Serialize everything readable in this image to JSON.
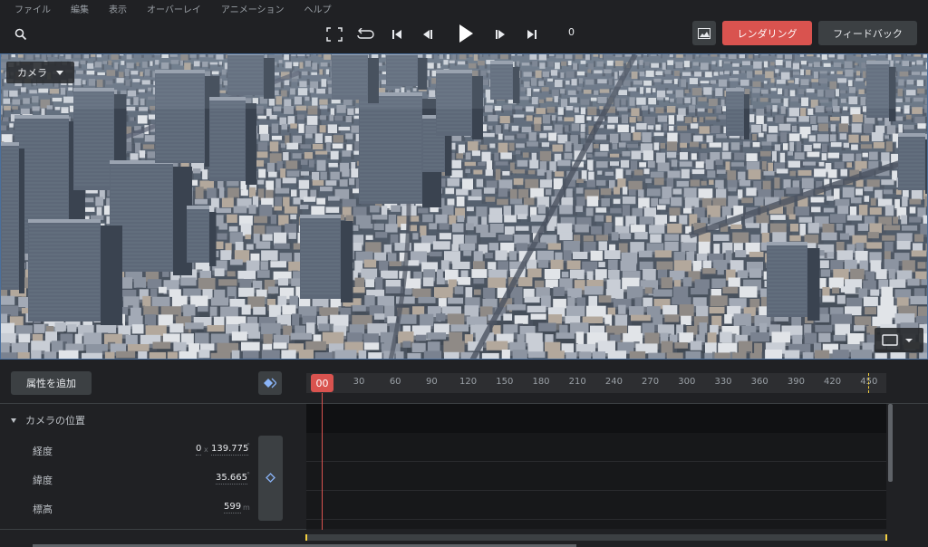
{
  "menu": [
    "ファイル",
    "編集",
    "表示",
    "オーバーレイ",
    "アニメーション",
    "ヘルプ"
  ],
  "toolbar": {
    "frame": "0",
    "render_label": "レンダリング",
    "feedback_label": "フィードバック"
  },
  "viewport": {
    "camera_label": "カメラ"
  },
  "timeline": {
    "add_property_label": "属性を追加",
    "playhead_label": "00",
    "ticks": [
      "30",
      "60",
      "90",
      "120",
      "150",
      "180",
      "210",
      "240",
      "270",
      "300",
      "330",
      "360",
      "390",
      "420",
      "450"
    ]
  },
  "properties": {
    "group_label": "カメラの位置",
    "longitude": {
      "label": "経度",
      "value_deg": "0",
      "value": "139.775",
      "unit": "°"
    },
    "latitude": {
      "label": "緯度",
      "value": "35.665",
      "unit": "°"
    },
    "altitude": {
      "label": "標高",
      "value": "599",
      "unit": "m"
    }
  },
  "colors": {
    "accent": "#d9534f",
    "keyframe": "#8ab4f8",
    "marker": "#f4d03f"
  }
}
